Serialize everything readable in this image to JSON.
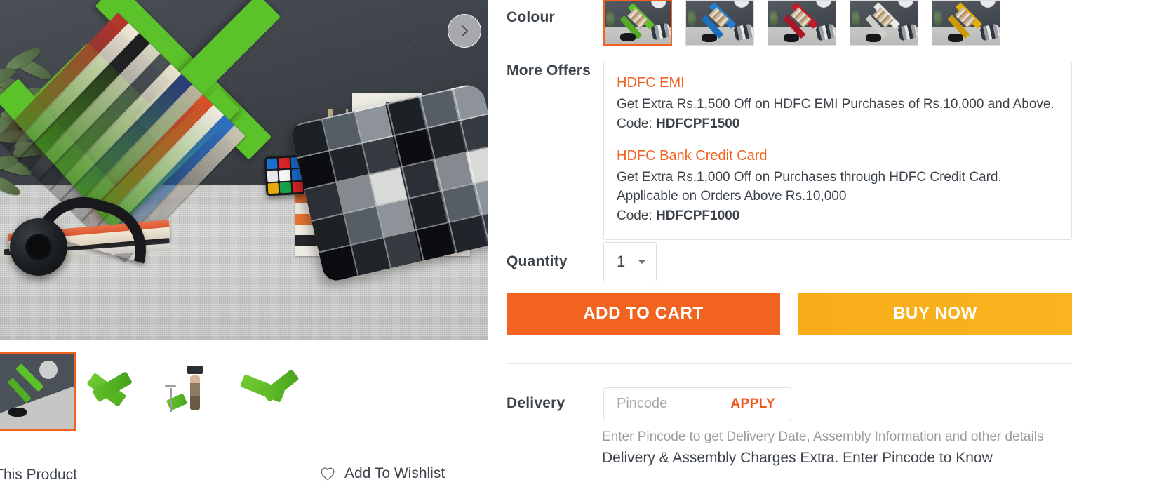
{
  "gallery": {
    "next_button_icon": "chevron-right-icon",
    "thumbnails": [
      {
        "name": "thumb-lifestyle-room",
        "selected": true
      },
      {
        "name": "thumb-shelf-angle",
        "selected": false
      },
      {
        "name": "thumb-shelf-with-model",
        "selected": false
      },
      {
        "name": "thumb-shelf-side",
        "selected": false
      }
    ],
    "share_label": "re This Product",
    "wishlist_label": "Add To Wishlist",
    "wishlist_icon": "heart-icon"
  },
  "colour": {
    "label": "Colour",
    "options": [
      {
        "name": "green",
        "hex": "#5cc22a",
        "selected": true
      },
      {
        "name": "blue",
        "hex": "#1f7fd4",
        "selected": false
      },
      {
        "name": "red",
        "hex": "#c4182b",
        "selected": false
      },
      {
        "name": "white",
        "hex": "#eceae6",
        "selected": false
      },
      {
        "name": "yellow",
        "hex": "#e8ae08",
        "selected": false
      }
    ]
  },
  "offers": {
    "label": "More Offers",
    "items": [
      {
        "title": "HDFC EMI",
        "description": "Get Extra Rs.1,500 Off on HDFC EMI Purchases of Rs.10,000 and Above.",
        "code_label": "Code:",
        "code": "HDFCPF1500"
      },
      {
        "title": "HDFC Bank Credit Card",
        "description": "Get Extra Rs.1,000 Off on Purchases through HDFC Credit Card. Applicable on Orders Above Rs.10,000",
        "code_label": "Code:",
        "code": "HDFCPF1000"
      }
    ]
  },
  "quantity": {
    "label": "Quantity",
    "value": "1",
    "caret_icon": "chevron-down-icon"
  },
  "actions": {
    "add_to_cart": "ADD TO CART",
    "buy_now": "BUY NOW"
  },
  "delivery": {
    "label": "Delivery",
    "pincode_placeholder": "Pincode",
    "pincode_value": "",
    "apply_label": "APPLY",
    "note": "Enter Pincode to get Delivery Date, Assembly Information and other details",
    "charges_note": "Delivery & Assembly Charges Extra. Enter Pincode to Know"
  },
  "colors": {
    "accent_orange": "#f26322",
    "cart_orange": "#f2631f",
    "buy_amber": "#f9b01d",
    "text_dark": "#3c434b",
    "muted": "#9b9b9b",
    "product_green": "#5cc22a"
  }
}
